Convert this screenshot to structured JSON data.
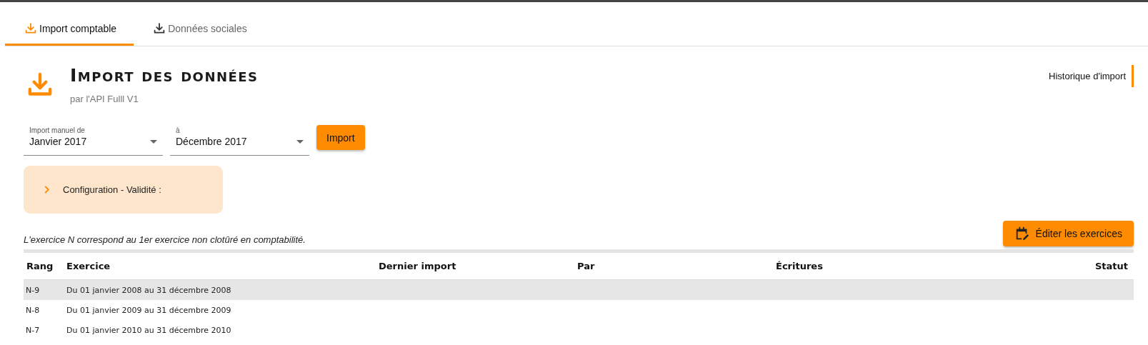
{
  "tabs": [
    {
      "label": "Import comptable",
      "selected": true
    },
    {
      "label": "Données sociales",
      "selected": false
    }
  ],
  "header": {
    "title": "Import des données",
    "subtitle": "par l'API Fulll V1",
    "history_link": "Historique d'import"
  },
  "import_form": {
    "from": {
      "label": "Import manuel de",
      "value": "Janvier 2017"
    },
    "to": {
      "label": "à",
      "value": "Décembre 2017"
    },
    "button": "Import"
  },
  "config_panel": {
    "title": "Configuration - Validité :",
    "expanded": false
  },
  "note": "L'exercice N correspond au 1er exercice non clotûré en comptabilité.",
  "edit_button": "Éditer les exercices",
  "table": {
    "columns": [
      "Rang",
      "Exercice",
      "Dernier import",
      "Par",
      "Écritures",
      "Statut"
    ],
    "rows": [
      {
        "rang": "N-9",
        "exercice": "Du 01 janvier 2008 au 31 décembre 2008",
        "hovered": true
      },
      {
        "rang": "N-8",
        "exercice": "Du 01 janvier 2009 au 31 décembre 2009",
        "hovered": false
      },
      {
        "rang": "N-7",
        "exercice": "Du 01 janvier 2010 au 31 décembre 2010",
        "hovered": false
      }
    ]
  }
}
